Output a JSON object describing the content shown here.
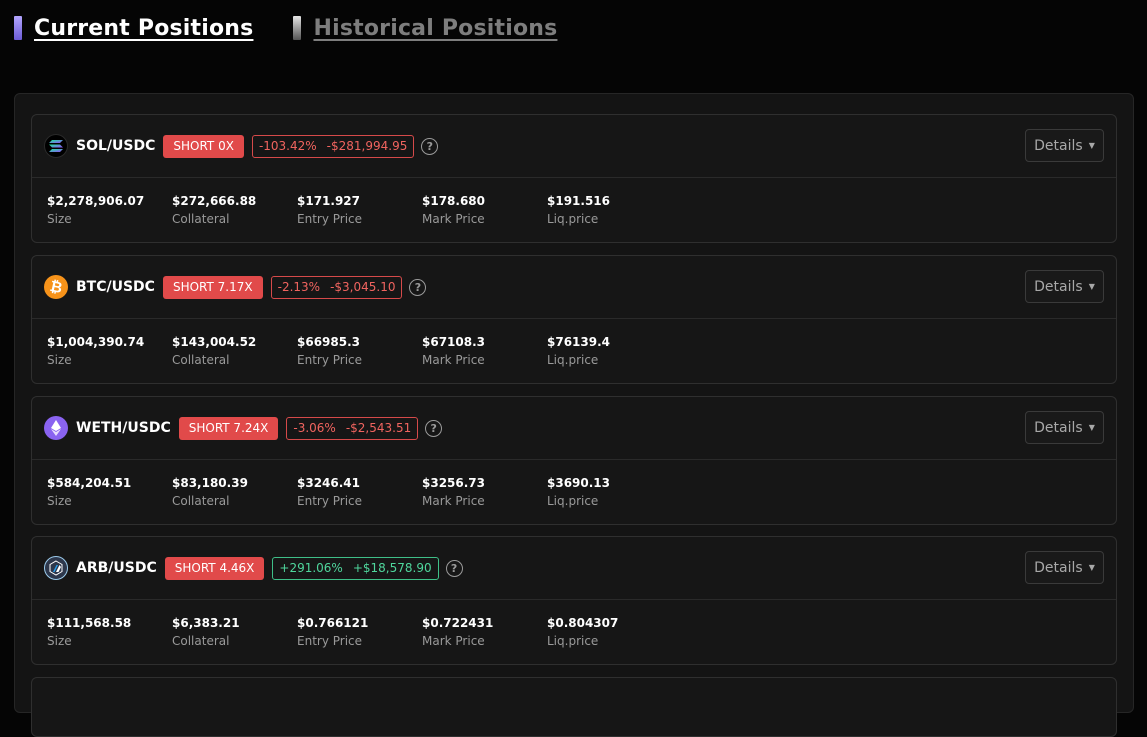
{
  "tabs": {
    "current": "Current Positions",
    "historical": "Historical Positions"
  },
  "colors": {
    "short_badge": "#e14a4a",
    "negative_pnl": "#f0645f",
    "positive_pnl": "#4fd69c",
    "current_tab_accent": "#8f7fff",
    "background": "#050505",
    "card": "#161616"
  },
  "positions": [
    {
      "pair": "SOL/USDC",
      "icon": "solana-icon",
      "side": "SHORT 0X",
      "pnl_percent": "-103.42%",
      "pnl_value": "-$281,994.95",
      "pnl_sign": "negative",
      "details_label": "Details",
      "stats": [
        {
          "value": "$2,278,906.07",
          "label": "Size"
        },
        {
          "value": "$272,666.88",
          "label": "Collateral"
        },
        {
          "value": "$171.927",
          "label": "Entry Price"
        },
        {
          "value": "$178.680",
          "label": "Mark Price"
        },
        {
          "value": "$191.516",
          "label": "Liq.price"
        }
      ]
    },
    {
      "pair": "BTC/USDC",
      "icon": "bitcoin-icon",
      "side": "SHORT 7.17X",
      "pnl_percent": "-2.13%",
      "pnl_value": "-$3,045.10",
      "pnl_sign": "negative",
      "details_label": "Details",
      "stats": [
        {
          "value": "$1,004,390.74",
          "label": "Size"
        },
        {
          "value": "$143,004.52",
          "label": "Collateral"
        },
        {
          "value": "$66985.3",
          "label": "Entry Price"
        },
        {
          "value": "$67108.3",
          "label": "Mark Price"
        },
        {
          "value": "$76139.4",
          "label": "Liq.price"
        }
      ]
    },
    {
      "pair": "WETH/USDC",
      "icon": "ethereum-icon",
      "side": "SHORT 7.24X",
      "pnl_percent": "-3.06%",
      "pnl_value": "-$2,543.51",
      "pnl_sign": "negative",
      "details_label": "Details",
      "stats": [
        {
          "value": "$584,204.51",
          "label": "Size"
        },
        {
          "value": "$83,180.39",
          "label": "Collateral"
        },
        {
          "value": "$3246.41",
          "label": "Entry Price"
        },
        {
          "value": "$3256.73",
          "label": "Mark Price"
        },
        {
          "value": "$3690.13",
          "label": "Liq.price"
        }
      ]
    },
    {
      "pair": "ARB/USDC",
      "icon": "arbitrum-icon",
      "side": "SHORT 4.46X",
      "pnl_percent": "+291.06%",
      "pnl_value": "+$18,578.90",
      "pnl_sign": "positive",
      "details_label": "Details",
      "stats": [
        {
          "value": "$111,568.58",
          "label": "Size"
        },
        {
          "value": "$6,383.21",
          "label": "Collateral"
        },
        {
          "value": "$0.766121",
          "label": "Entry Price"
        },
        {
          "value": "$0.722431",
          "label": "Mark Price"
        },
        {
          "value": "$0.804307",
          "label": "Liq.price"
        }
      ]
    }
  ]
}
